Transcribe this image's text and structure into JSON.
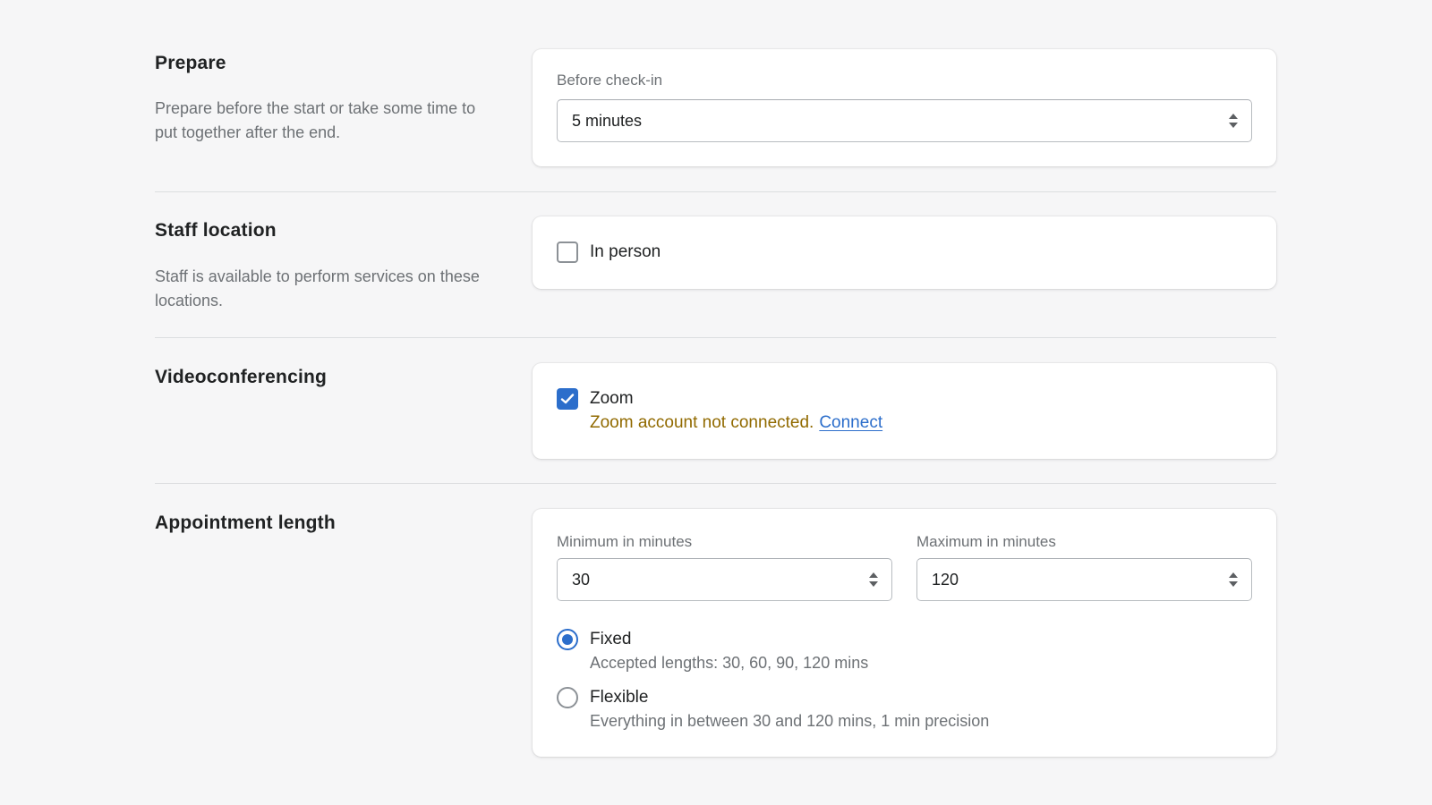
{
  "prepare": {
    "title": "Prepare",
    "description": "Prepare before the start or take some time to put together after the end.",
    "field_label": "Before check-in",
    "field_value": "5 minutes"
  },
  "staff_location": {
    "title": "Staff location",
    "description": "Staff is available to perform services on these locations.",
    "option_label": "In person",
    "option_checked": false
  },
  "videoconferencing": {
    "title": "Videoconferencing",
    "option_label": "Zoom",
    "option_checked": true,
    "warning": "Zoom account not connected.",
    "link_label": "Connect"
  },
  "appointment_length": {
    "title": "Appointment length",
    "min_label": "Minimum in minutes",
    "min_value": "30",
    "max_label": "Maximum in minutes",
    "max_value": "120",
    "options": [
      {
        "label": "Fixed",
        "help": "Accepted lengths: 30, 60, 90, 120 mins",
        "checked": true
      },
      {
        "label": "Flexible",
        "help": "Everything in between 30 and 120 mins, 1 min precision",
        "checked": false
      }
    ]
  },
  "colors": {
    "accent": "#2c6ecb",
    "warning": "#916a00",
    "background": "#f6f6f7"
  }
}
